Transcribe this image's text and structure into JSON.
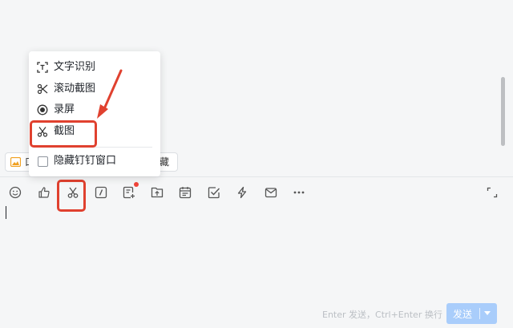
{
  "menu": {
    "items": [
      {
        "label": "文字识别",
        "icon": "text-recognition-icon"
      },
      {
        "label": "滚动截图",
        "icon": "scroll-screenshot-icon"
      },
      {
        "label": "录屏",
        "icon": "record-screen-icon"
      },
      {
        "label": "截图",
        "icon": "scissors-icon"
      }
    ],
    "hide_window_label": "隐藏钉钉窗口",
    "hide_window_checked": false
  },
  "chips": {
    "left_text": "口",
    "right_text": "藏"
  },
  "toolbar": {
    "icons": [
      "emoji-icon",
      "thumbs-up-icon",
      "scissors-icon",
      "slash-command-icon",
      "doc-plus-icon",
      "upload-icon",
      "calendar-icon",
      "task-check-icon",
      "lightning-icon",
      "mail-icon",
      "more-icon",
      "expand-icon"
    ]
  },
  "footer": {
    "hint": "Enter 发送，Ctrl+Enter 换行",
    "send_label": "发送"
  },
  "colors": {
    "annotation_red": "#e0412f",
    "send_button": "#a9cdfb",
    "badge": "#f04438"
  }
}
